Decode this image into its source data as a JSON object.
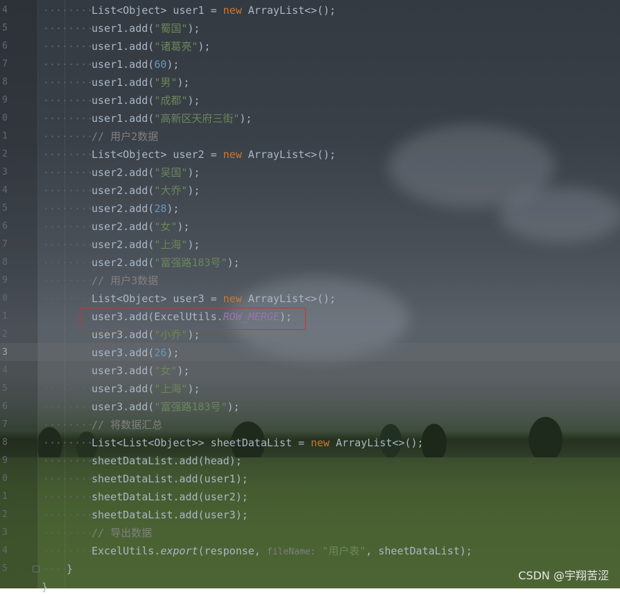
{
  "editor": {
    "lines": [
      {
        "num": "4",
        "indent": "········",
        "tokens": [
          [
            "List<Object> user1 = ",
            ""
          ],
          [
            "new",
            "kw"
          ],
          [
            " ArrayList<>();",
            ""
          ]
        ]
      },
      {
        "num": "5",
        "indent": "········",
        "tokens": [
          [
            "user1.add(",
            ""
          ],
          [
            "\"蜀国\"",
            "str"
          ],
          [
            ");",
            ""
          ]
        ]
      },
      {
        "num": "6",
        "indent": "········",
        "tokens": [
          [
            "user1.add(",
            ""
          ],
          [
            "\"诸葛亮\"",
            "str"
          ],
          [
            ");",
            ""
          ]
        ]
      },
      {
        "num": "7",
        "indent": "········",
        "tokens": [
          [
            "user1.add(",
            ""
          ],
          [
            "60",
            "num"
          ],
          [
            ");",
            ""
          ]
        ]
      },
      {
        "num": "8",
        "indent": "········",
        "tokens": [
          [
            "user1.add(",
            ""
          ],
          [
            "\"男\"",
            "str"
          ],
          [
            ");",
            ""
          ]
        ]
      },
      {
        "num": "9",
        "indent": "········",
        "tokens": [
          [
            "user1.add(",
            ""
          ],
          [
            "\"成都\"",
            "str"
          ],
          [
            ");",
            ""
          ]
        ]
      },
      {
        "num": "0",
        "indent": "········",
        "tokens": [
          [
            "user1.add(",
            ""
          ],
          [
            "\"高新区天府三街\"",
            "str"
          ],
          [
            ");",
            ""
          ]
        ]
      },
      {
        "num": "1",
        "indent": "········",
        "tokens": [
          [
            "// 用户2数据",
            "com"
          ]
        ]
      },
      {
        "num": "2",
        "indent": "········",
        "tokens": [
          [
            "List<Object> user2 = ",
            ""
          ],
          [
            "new",
            "kw"
          ],
          [
            " ArrayList<>();",
            ""
          ]
        ]
      },
      {
        "num": "3",
        "indent": "········",
        "tokens": [
          [
            "user2.add(",
            ""
          ],
          [
            "\"吴国\"",
            "str"
          ],
          [
            ");",
            ""
          ]
        ]
      },
      {
        "num": "4",
        "indent": "········",
        "tokens": [
          [
            "user2.add(",
            ""
          ],
          [
            "\"大乔\"",
            "str"
          ],
          [
            ");",
            ""
          ]
        ]
      },
      {
        "num": "5",
        "indent": "········",
        "tokens": [
          [
            "user2.add(",
            ""
          ],
          [
            "28",
            "num"
          ],
          [
            ");",
            ""
          ]
        ]
      },
      {
        "num": "6",
        "indent": "········",
        "tokens": [
          [
            "user2.add(",
            ""
          ],
          [
            "\"女\"",
            "str"
          ],
          [
            ");",
            ""
          ]
        ]
      },
      {
        "num": "7",
        "indent": "········",
        "tokens": [
          [
            "user2.add(",
            ""
          ],
          [
            "\"上海\"",
            "str"
          ],
          [
            ");",
            ""
          ]
        ]
      },
      {
        "num": "8",
        "indent": "········",
        "tokens": [
          [
            "user2.add(",
            ""
          ],
          [
            "\"富强路183号\"",
            "str"
          ],
          [
            ");",
            ""
          ]
        ]
      },
      {
        "num": "9",
        "indent": "········",
        "tokens": [
          [
            "// 用户3数据",
            "com"
          ]
        ]
      },
      {
        "num": "0",
        "indent": "········",
        "tokens": [
          [
            "List<Object> user3 = ",
            ""
          ],
          [
            "new",
            "kw"
          ],
          [
            " ArrayList<>();",
            ""
          ]
        ]
      },
      {
        "num": "1",
        "indent": "········",
        "tokens": [
          [
            "user3.add(ExcelUtils.",
            ""
          ],
          [
            "ROW_MERGE",
            "fld"
          ],
          [
            ");",
            ""
          ]
        ]
      },
      {
        "num": "2",
        "indent": "········",
        "tokens": [
          [
            "user3.add(",
            ""
          ],
          [
            "\"小乔\"",
            "str"
          ],
          [
            ");",
            ""
          ]
        ]
      },
      {
        "num": "3",
        "indent": "········",
        "current": true,
        "tokens": [
          [
            "user3.add(",
            ""
          ],
          [
            "26",
            "num"
          ],
          [
            ");",
            ""
          ]
        ]
      },
      {
        "num": "4",
        "indent": "········",
        "tokens": [
          [
            "user3.add(",
            ""
          ],
          [
            "\"女\"",
            "str"
          ],
          [
            ");",
            ""
          ]
        ]
      },
      {
        "num": "5",
        "indent": "········",
        "tokens": [
          [
            "user3.add(",
            ""
          ],
          [
            "\"上海\"",
            "str"
          ],
          [
            ");",
            ""
          ]
        ]
      },
      {
        "num": "6",
        "indent": "········",
        "tokens": [
          [
            "user3.add(",
            ""
          ],
          [
            "\"富强路183号\"",
            "str"
          ],
          [
            ");",
            ""
          ]
        ]
      },
      {
        "num": "7",
        "indent": "········",
        "tokens": [
          [
            "// 将数据汇总",
            "com"
          ]
        ]
      },
      {
        "num": "8",
        "indent": "········",
        "tokens": [
          [
            "List<List<Object>> sheetDataList = ",
            ""
          ],
          [
            "new",
            "kw"
          ],
          [
            " ArrayList<>();",
            ""
          ]
        ]
      },
      {
        "num": "9",
        "indent": "········",
        "tokens": [
          [
            "sheetDataList.add(head);",
            ""
          ]
        ]
      },
      {
        "num": "0",
        "indent": "········",
        "tokens": [
          [
            "sheetDataList.add(user1);",
            ""
          ]
        ]
      },
      {
        "num": "1",
        "indent": "········",
        "tokens": [
          [
            "sheetDataList.add(user2);",
            ""
          ]
        ]
      },
      {
        "num": "2",
        "indent": "········",
        "tokens": [
          [
            "sheetDataList.add(user3);",
            ""
          ]
        ]
      },
      {
        "num": "3",
        "indent": "········",
        "tokens": [
          [
            "// 导出数据",
            "com"
          ]
        ]
      },
      {
        "num": "4",
        "indent": "········",
        "tokens": [
          [
            "ExcelUtils.",
            ""
          ],
          [
            "export",
            "mtd"
          ],
          [
            "(response, ",
            ""
          ],
          [
            "fileName:",
            "hint"
          ],
          [
            " ",
            ""
          ],
          [
            "\"用户表\"",
            "str"
          ],
          [
            ", sheetDataList);",
            ""
          ]
        ]
      },
      {
        "num": "5",
        "indent": "····",
        "tokens": [
          [
            "}",
            ""
          ]
        ]
      },
      {
        "num": "",
        "indent": "",
        "tokens": [
          [
            "}",
            ""
          ]
        ]
      }
    ]
  },
  "watermark": {
    "text": "CSDN @宇翔苦涩"
  },
  "colors": {
    "keyword": "#cc7832",
    "string": "#6a8759",
    "number": "#6897bb",
    "comment": "#808080",
    "field": "#9876aa",
    "highlight_box": "#d32f2f"
  }
}
